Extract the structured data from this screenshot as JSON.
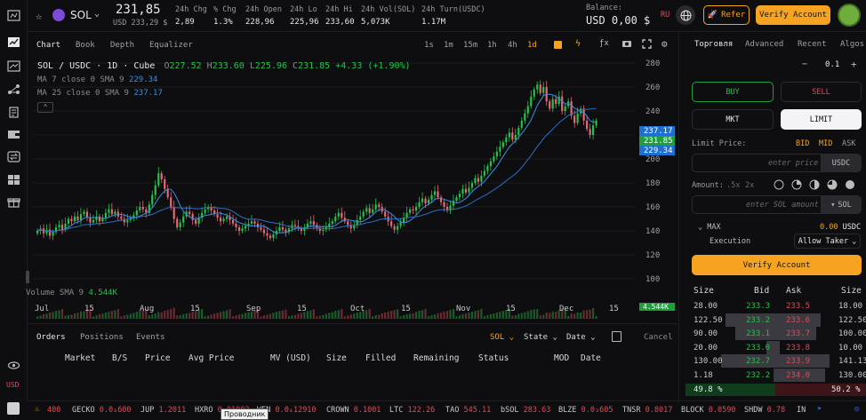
{
  "market": {
    "symbol": "SOL",
    "price": "231,85",
    "price_usd": "USD 233,29 $",
    "stats": [
      {
        "label": "24h Chg",
        "value": "2,89",
        "tone": "green"
      },
      {
        "label": "% Chg",
        "value": "1.3%",
        "tone": "green"
      },
      {
        "label": "24h Open",
        "value": "228,96",
        "tone": "white"
      },
      {
        "label": "24h Lo",
        "value": "225,96",
        "tone": "white"
      },
      {
        "label": "24h Hi",
        "value": "233,60",
        "tone": "white"
      },
      {
        "label": "24h Vol(SOL)",
        "value": "5,073K",
        "tone": "white"
      },
      {
        "label": "24h Turn(USDC)",
        "value": "1.17M",
        "tone": "white"
      }
    ]
  },
  "header": {
    "balance_label": "Balance:",
    "balance_value": "USD 0,00 $",
    "lang": "RU",
    "refer_label": "Refer",
    "verify_label": "Verify Account"
  },
  "chart_panel": {
    "tabs": [
      "Chart",
      "Book",
      "Depth",
      "Equalizer"
    ],
    "active_tab": "Chart",
    "timeframes": [
      "1s",
      "1m",
      "15m",
      "1h",
      "4h",
      "1d"
    ],
    "active_timeframe": "1d"
  },
  "chart_data": {
    "type": "candlestick",
    "title": "SOL / USDC · 1D · Cube",
    "ohlc_readout": {
      "O": "227.52",
      "H": "233.60",
      "L": "225.96",
      "C": "231.85",
      "chg": "+4.33 (+1.90%)"
    },
    "ma_lines": [
      {
        "label": "MA 7 close 0 SMA 9",
        "value": "229.34",
        "color": "#3a8de0"
      },
      {
        "label": "MA 25 close 0 SMA 9",
        "value": "237.17",
        "color": "#3a8de0"
      }
    ],
    "volume_label": "Volume SMA 9",
    "volume_value": "4.544K",
    "y_ticks": [
      280,
      260,
      240,
      220,
      200,
      180,
      160,
      140,
      120,
      100
    ],
    "ylim": [
      100,
      280
    ],
    "x_ticks": [
      "Jul",
      "15",
      "Aug",
      "15",
      "Sep",
      "15",
      "Oct",
      "15",
      "Nov",
      "15",
      "Dec",
      "15"
    ],
    "price_tags": [
      {
        "value": "237.17",
        "color": "#1e6fd0"
      },
      {
        "value": "231.85",
        "color": "#1f9e3c"
      },
      {
        "value": "229.34",
        "color": "#1e6fd0"
      }
    ],
    "candles_close": [
      140,
      142,
      138,
      141,
      136,
      139,
      143,
      145,
      141,
      146,
      150,
      148,
      152,
      149,
      154,
      156,
      151,
      147,
      149,
      152,
      148,
      151,
      155,
      158,
      154,
      156,
      152,
      150,
      147,
      149,
      151,
      153,
      157,
      160,
      158,
      155,
      162,
      170,
      178,
      188,
      183,
      175,
      168,
      160,
      150,
      143,
      147,
      152,
      156,
      154,
      149,
      146,
      151,
      155,
      158,
      160,
      157,
      154,
      151,
      148,
      150,
      152,
      149,
      146,
      143,
      140,
      142,
      144,
      146,
      148,
      146,
      143,
      141,
      138,
      136,
      134,
      137,
      140,
      143,
      141,
      139,
      142,
      145,
      144,
      142,
      140,
      143,
      146,
      148,
      145,
      142,
      140,
      141,
      143,
      146,
      148,
      152,
      155,
      151,
      148,
      145,
      142,
      145,
      149,
      152,
      156,
      159,
      155,
      158,
      162,
      160,
      156,
      152,
      148,
      144,
      141,
      144,
      147,
      151,
      155,
      158,
      157,
      160,
      164,
      167,
      163,
      166,
      170,
      173,
      168,
      164,
      160,
      157,
      161,
      165,
      168,
      171,
      175,
      172,
      176,
      180,
      184,
      181,
      186,
      190,
      194,
      198,
      202,
      206,
      210,
      214,
      218,
      222,
      216,
      220,
      226,
      232,
      238,
      244,
      252,
      258,
      262,
      255,
      260,
      248,
      242,
      250,
      246,
      252,
      240,
      244,
      248,
      236,
      230,
      238,
      242,
      232,
      225,
      220,
      228,
      232
    ]
  },
  "orders": {
    "tabs": [
      "Orders",
      "Positions",
      "Events"
    ],
    "active_tab": "Orders",
    "filters": [
      "SOL",
      "State",
      "Date"
    ],
    "cancel_label": "Cancel",
    "columns": [
      "Market",
      "B/S",
      "Price",
      "Avg Price",
      "MV (USD)",
      "Size",
      "Filled",
      "Remaining",
      "Status",
      "MOD",
      "Date"
    ]
  },
  "trade": {
    "tabs": [
      "Торговля",
      "Advanced",
      "Recent",
      "Algos"
    ],
    "active_tab": "Торговля",
    "tick_size": "0.1",
    "buy_label": "BUY",
    "sell_label": "SELL",
    "mkt_label": "MKT",
    "limit_label": "LIMIT",
    "limit_price_label": "Limit Price:",
    "price_modes": [
      "BID",
      "MID",
      "ASK"
    ],
    "price_placeholder": "enter price",
    "price_unit": "USDC",
    "amount_label": "Amount:",
    "amount_multipliers": [
      ".5x",
      "2x"
    ],
    "amount_placeholder": "enter SOL amount",
    "amount_unit": "SOL",
    "max_label": "MAX",
    "max_value": "0.00",
    "max_unit": "USDC",
    "execution_label": "Execution",
    "execution_value": "Allow Taker",
    "verify_label": "Verify Account"
  },
  "orderbook": {
    "headers": [
      "Size",
      "Bid",
      "Ask",
      "Size"
    ],
    "rows": [
      {
        "bid_size": "28.00",
        "bid": "233.3",
        "ask": "233.5",
        "ask_size": "18.00",
        "bid_depth": 0.0,
        "ask_depth": 0.0
      },
      {
        "bid_size": "122.50",
        "bid": "233.2",
        "ask": "233.6",
        "ask_size": "122.50",
        "bid_depth": 0.55,
        "ask_depth": 0.5
      },
      {
        "bid_size": "90.00",
        "bid": "233.1",
        "ask": "233.7",
        "ask_size": "100.00",
        "bid_depth": 0.45,
        "ask_depth": 0.45
      },
      {
        "bid_size": "20.00",
        "bid": "233.0",
        "ask": "233.8",
        "ask_size": "10.00",
        "bid_depth": 0.1,
        "ask_depth": 0.05
      },
      {
        "bid_size": "130.00",
        "bid": "232.7",
        "ask": "233.9",
        "ask_size": "141.13",
        "bid_depth": 0.6,
        "ask_depth": 0.6
      },
      {
        "bid_size": "1.18",
        "bid": "232.2",
        "ask": "234.0",
        "ask_size": "130.00",
        "bid_depth": 0.02,
        "ask_depth": 0.55
      }
    ],
    "bid_pct": "49.8 %",
    "ask_pct": "50.2 %"
  },
  "ticker": [
    {
      "sym": "",
      "val": "400",
      "tone": "red"
    },
    {
      "sym": "GECKO",
      "val": "0.0₄600",
      "tone": "red"
    },
    {
      "sym": "JUP",
      "val": "1.2011",
      "tone": "red"
    },
    {
      "sym": "HXRO",
      "val": "0.01002",
      "tone": "red"
    },
    {
      "sym": "WEN",
      "val": "0.0₄12910",
      "tone": "red"
    },
    {
      "sym": "CROWN",
      "val": "0.1001",
      "tone": "red"
    },
    {
      "sym": "LTC",
      "val": "122.26",
      "tone": "red"
    },
    {
      "sym": "TAO",
      "val": "545.11",
      "tone": "red"
    },
    {
      "sym": "bSOL",
      "val": "283.63",
      "tone": "red"
    },
    {
      "sym": "BLZE",
      "val": "0.0₃605",
      "tone": "red"
    },
    {
      "sym": "TNSR",
      "val": "0.8017",
      "tone": "red"
    },
    {
      "sym": "BLOCK",
      "val": "0.0590",
      "tone": "red"
    },
    {
      "sym": "SHDW",
      "val": "0.78",
      "tone": "red"
    },
    {
      "sym": "IN",
      "val": "",
      "tone": "white"
    }
  ],
  "tooltip": "Проводник",
  "rail_bottom": {
    "currency": "USD"
  },
  "colors": {
    "accent": "#f5a321",
    "up": "#26c24a",
    "down": "#e04a58",
    "ma": "#3a8de0"
  }
}
